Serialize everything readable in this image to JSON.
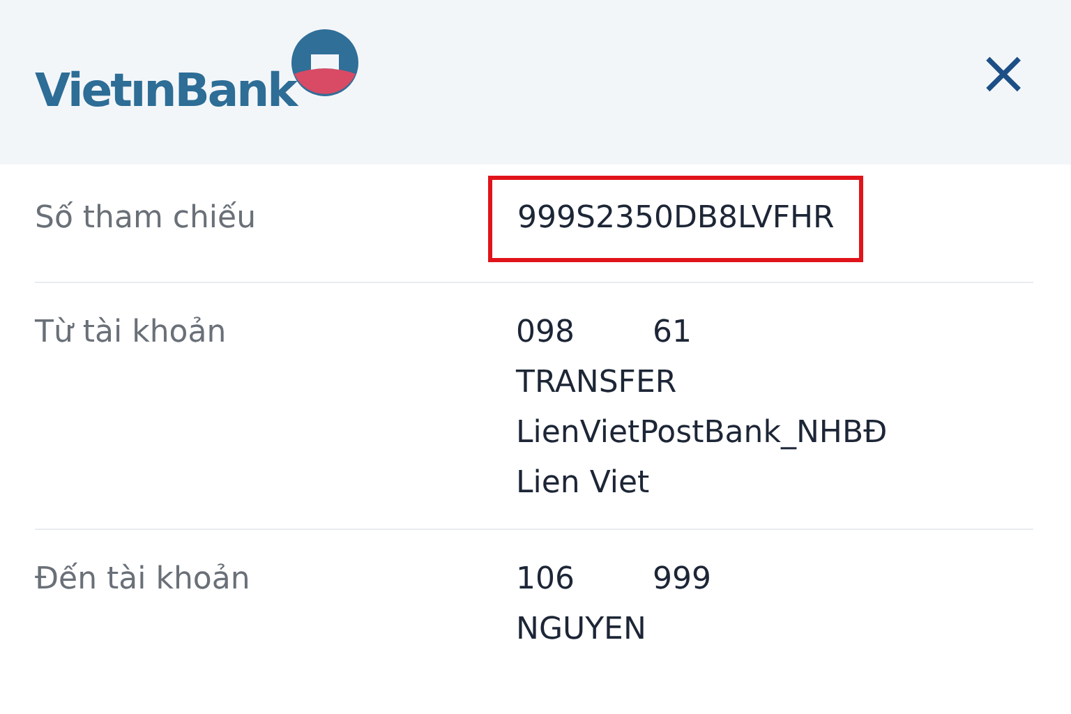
{
  "header": {
    "logo_text": "VietınBank",
    "close": "×"
  },
  "rows": [
    {
      "label": "Số tham chiếu",
      "highlighted": true,
      "lines": [
        [
          "999S2350DB8LVFHR"
        ]
      ]
    },
    {
      "label": "Từ tài khoản",
      "highlighted": false,
      "lines": [
        [
          "098",
          "61"
        ],
        [
          "TRANSFER"
        ],
        [
          "LienVietPostBank_NHBĐ"
        ],
        [
          "Lien Viet"
        ]
      ]
    },
    {
      "label": "Đến tài khoản",
      "highlighted": false,
      "lines": [
        [
          "106",
          "999"
        ],
        [
          "NGUYEN"
        ]
      ]
    }
  ]
}
